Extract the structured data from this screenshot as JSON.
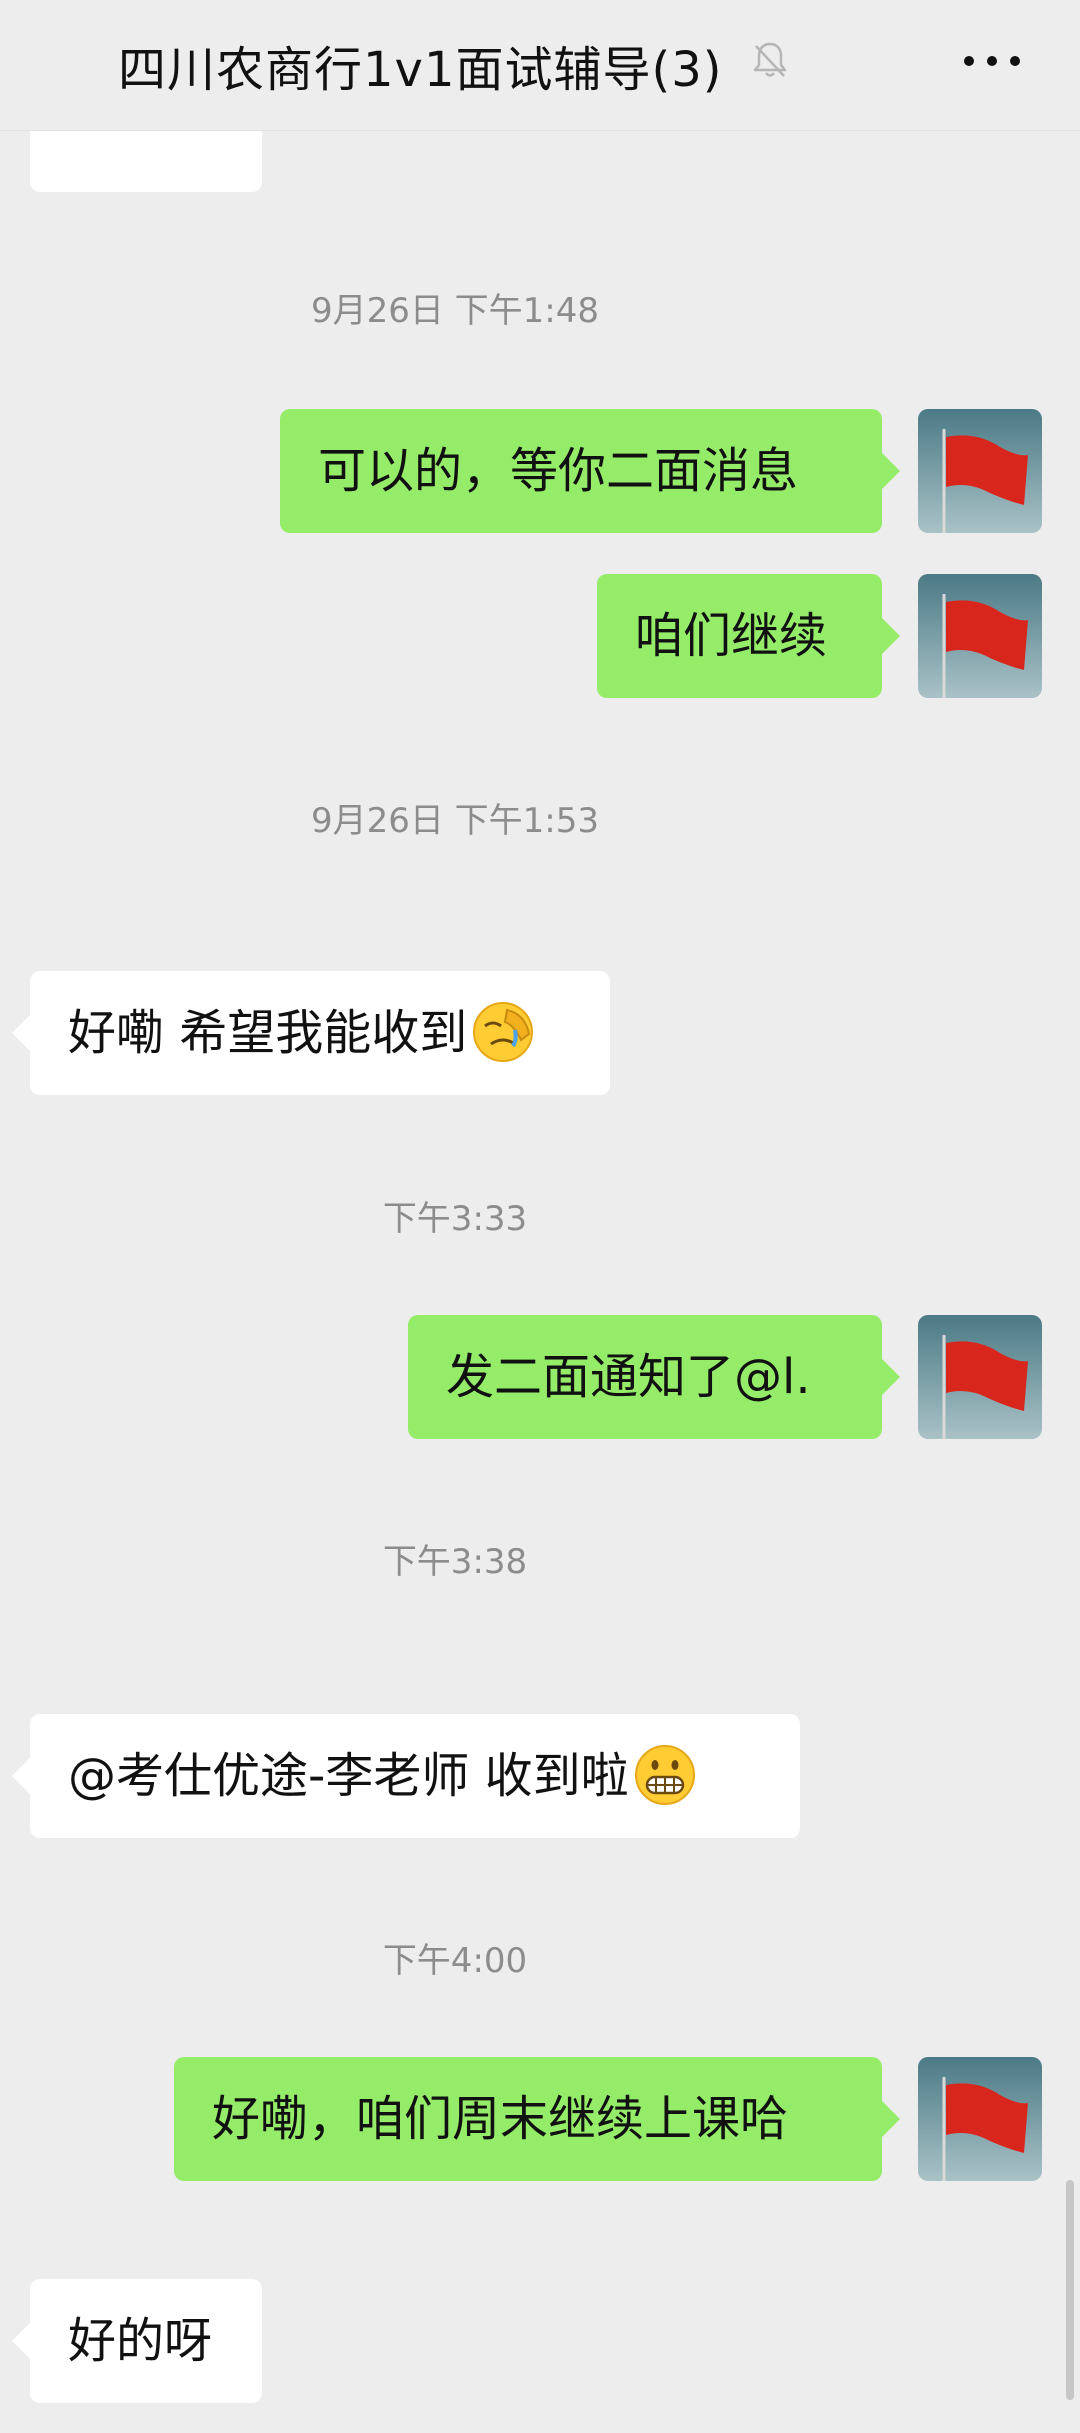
{
  "header": {
    "title": "四川农商行1v1面试辅导(3)",
    "mute_icon": "bell-off-icon",
    "more_icon": "more-dots-icon"
  },
  "colors": {
    "outgoing_bubble": "#95ec69",
    "incoming_bubble": "#ffffff",
    "background": "#ededed",
    "timestamp_text": "#8c8c8c"
  },
  "messages": [
    {
      "type": "timestamp",
      "text": "9月26日 下午1:48"
    },
    {
      "type": "outgoing",
      "text": "可以的，等你二面消息"
    },
    {
      "type": "outgoing",
      "text": "咱们继续"
    },
    {
      "type": "timestamp",
      "text": "9月26日 下午1:53"
    },
    {
      "type": "incoming",
      "text": "好嘞 希望我能收到",
      "emoji": "face-palm-crying-emoji"
    },
    {
      "type": "timestamp",
      "text": "下午3:33"
    },
    {
      "type": "outgoing",
      "text": "发二面通知了@l."
    },
    {
      "type": "timestamp",
      "text": "下午3:38"
    },
    {
      "type": "incoming",
      "text": "@考仕优途-李老师  收到啦",
      "emoji": "grinning-face-emoji"
    },
    {
      "type": "timestamp",
      "text": "下午4:00"
    },
    {
      "type": "outgoing",
      "text": "好嘞，咱们周末继续上课哈"
    },
    {
      "type": "incoming",
      "text": "好的呀"
    }
  ],
  "avatar_icon": "red-flag-avatar"
}
